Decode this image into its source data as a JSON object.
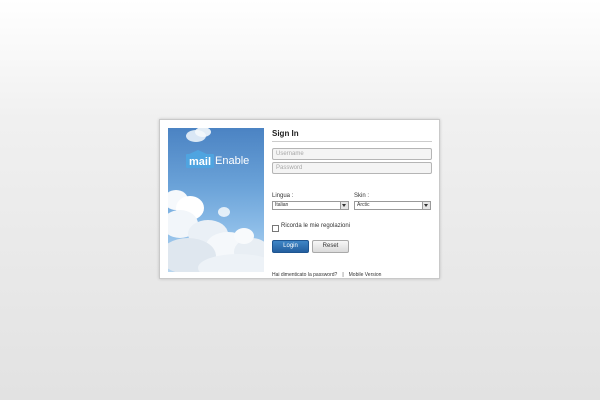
{
  "logo": {
    "mail": "mail",
    "enable": "Enable"
  },
  "form": {
    "title": "Sign In",
    "username_placeholder": "Username",
    "password_placeholder": "Password",
    "language_label": "Lingua :",
    "language_value": "Italian",
    "skin_label": "Skin :",
    "skin_value": "Arctic",
    "remember_label": "Ricorda le mie regolazioni",
    "login_button": "Login",
    "reset_button": "Reset"
  },
  "footer": {
    "forgot_password": "Hai dimenticato la password?",
    "separator": "|",
    "mobile_version": "Mobile Version"
  },
  "colors": {
    "login_button": "#2d6fb0",
    "sky_top": "#4b83c3",
    "sky_bottom": "#b8d6ef"
  }
}
